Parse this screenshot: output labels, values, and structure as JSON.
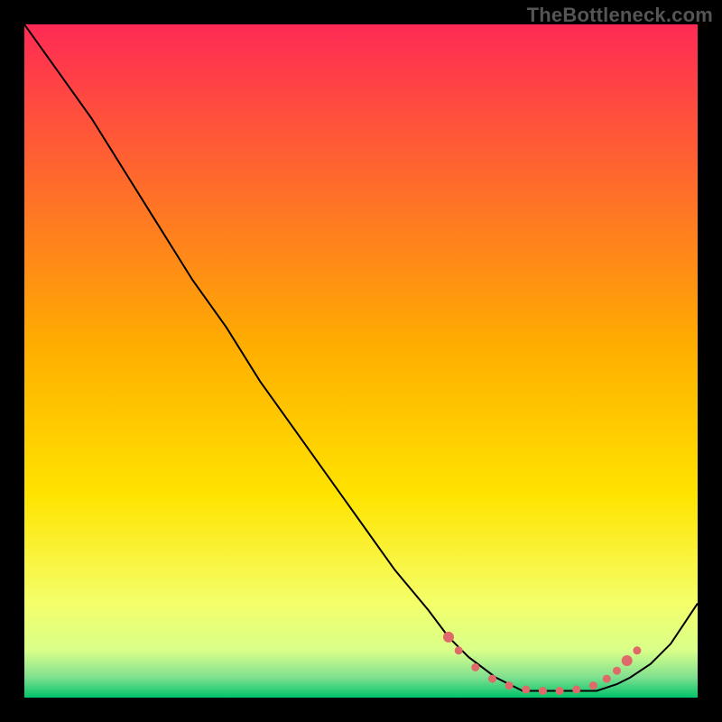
{
  "watermark": "TheBottleneck.com",
  "chart_data": {
    "type": "line",
    "title": "",
    "xlabel": "",
    "ylabel": "",
    "xlim": [
      0,
      100
    ],
    "ylim": [
      0,
      100
    ],
    "grid": false,
    "legend": false,
    "background_gradient_top": "#ff2a55",
    "background_gradient_mid": "#ffd400",
    "background_gradient_lowband_top": "#f4ff6a",
    "background_gradient_bottom": "#00c46a",
    "series": [
      {
        "name": "curve",
        "color": "#000000",
        "stroke_width": 2,
        "x": [
          0,
          5,
          10,
          15,
          20,
          25,
          30,
          35,
          40,
          45,
          50,
          55,
          60,
          63,
          66,
          70,
          74,
          78,
          82,
          85,
          88,
          90,
          93,
          96,
          98,
          100
        ],
        "y": [
          100,
          93,
          86,
          78,
          70,
          62,
          55,
          47,
          40,
          33,
          26,
          19,
          13,
          9,
          6,
          3,
          1,
          1,
          1,
          1,
          2,
          3,
          5,
          8,
          11,
          14
        ]
      }
    ],
    "markers": {
      "name": "flat-region-dots",
      "color": "#e06a6a",
      "radius_large": 6,
      "radius_small": 4.5,
      "points": [
        {
          "x": 63.0,
          "y": 9.0,
          "r": "large"
        },
        {
          "x": 64.5,
          "y": 7.0,
          "r": "small"
        },
        {
          "x": 67.0,
          "y": 4.5,
          "r": "small"
        },
        {
          "x": 69.5,
          "y": 2.8,
          "r": "small"
        },
        {
          "x": 72.0,
          "y": 1.8,
          "r": "small"
        },
        {
          "x": 74.5,
          "y": 1.2,
          "r": "small"
        },
        {
          "x": 77.0,
          "y": 1.0,
          "r": "small"
        },
        {
          "x": 79.5,
          "y": 1.0,
          "r": "small"
        },
        {
          "x": 82.0,
          "y": 1.2,
          "r": "small"
        },
        {
          "x": 84.5,
          "y": 1.8,
          "r": "small"
        },
        {
          "x": 86.5,
          "y": 2.8,
          "r": "small"
        },
        {
          "x": 88.0,
          "y": 4.0,
          "r": "small"
        },
        {
          "x": 89.5,
          "y": 5.5,
          "r": "large"
        },
        {
          "x": 91.0,
          "y": 7.0,
          "r": "small"
        }
      ]
    }
  }
}
